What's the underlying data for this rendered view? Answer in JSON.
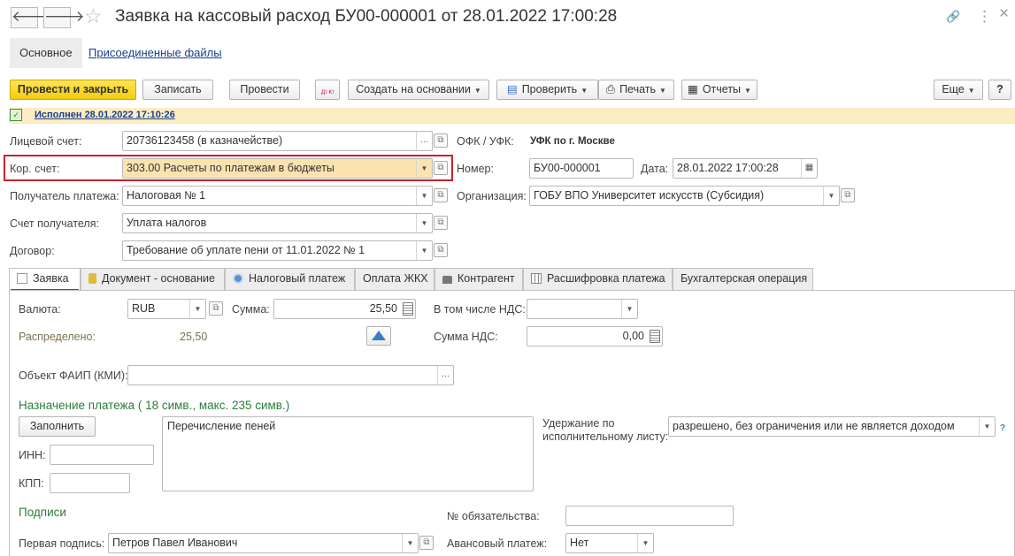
{
  "window": {
    "title": "Заявка на кассовый расход БУ00-000001 от 28.01.2022 17:00:28",
    "back_glyph": "🡐",
    "forward_glyph": "🡒",
    "star_glyph": "☆",
    "link_glyph": "🔗",
    "more_glyph": "⋮",
    "close_glyph": "×"
  },
  "top_tabs": {
    "main": "Основное",
    "files": "Присоединенные файлы"
  },
  "toolbar": {
    "post_close": "Провести и закрыть",
    "write": "Записать",
    "post": "Провести",
    "dt_kt": "Дт Кт",
    "create_based": "Создать на основании",
    "check": "Проверить",
    "print": "Печать",
    "reports": "Отчеты",
    "more": "Еще",
    "help": "?"
  },
  "status": {
    "text": "Исполнен 28.01.2022 17:10:26"
  },
  "header": {
    "account_label": "Лицевой счет:",
    "account_value": "20736123458 (в казначействе)",
    "corr_label": "Кор. счет:",
    "corr_value": "303.00 Расчеты по платежам в бюджеты",
    "recipient_label": "Получатель платежа:",
    "recipient_value": "Налоговая № 1",
    "recipient_account_label": "Счет получателя:",
    "recipient_account_value": "Уплата налогов",
    "contract_label": "Договор:",
    "contract_value": "Требование об уплате пени от 11.01.2022 № 1",
    "ofk_label": "ОФК / УФК:",
    "ofk_value": "УФК по г. Москве",
    "number_label": "Номер:",
    "number_value": "БУ00-000001",
    "date_label": "Дата:",
    "date_value": "28.01.2022 17:00:28",
    "org_label": "Организация:",
    "org_value": "ГОБУ ВПО Университет искусств (Субсидия)"
  },
  "tabs": [
    "Заявка",
    "Документ - основание",
    "Налоговый платеж",
    "Оплата ЖКХ",
    "Контрагент",
    "Расшифровка платежа",
    "Бухгалтерская операция"
  ],
  "request": {
    "currency_label": "Валюта:",
    "currency_value": "RUB",
    "sum_label": "Сумма:",
    "sum_value": "25,50",
    "vat_incl_label": "В том числе НДС:",
    "vat_incl_value": "",
    "distributed_label": "Распределено:",
    "distributed_value": "25,50",
    "vat_sum_label": "Сумма НДС:",
    "vat_sum_value": "0,00",
    "faip_label": "Объект ФАИП (КМИ):",
    "faip_value": "",
    "purpose_title": "Назначение платежа ( 18 симв., макс. 235 симв.)",
    "fill_button": "Заполнить",
    "purpose_text": "Перечисление пеней",
    "inn_label": "ИНН:",
    "inn_value": "",
    "kpp_label": "КПП:",
    "kpp_value": "",
    "withhold_label_1": "Удержание по",
    "withhold_label_2": "исполнительному листу:",
    "withhold_value": "разрешено, без ограничения или не является доходом",
    "withhold_help": "?",
    "signatures_title": "Подписи",
    "obligation_label": "№ обязательства:",
    "obligation_value": "",
    "first_sign_label": "Первая подпись:",
    "first_sign_value": "Петров Павел Иванович",
    "advance_label": "Авансовый платеж:",
    "advance_value": "Нет"
  },
  "colors": {
    "accent_yellow": "#f3cc0c",
    "highlight_red": "#d0202b",
    "status_bg": "#fbecc2",
    "section_green": "#2a7d3a"
  }
}
